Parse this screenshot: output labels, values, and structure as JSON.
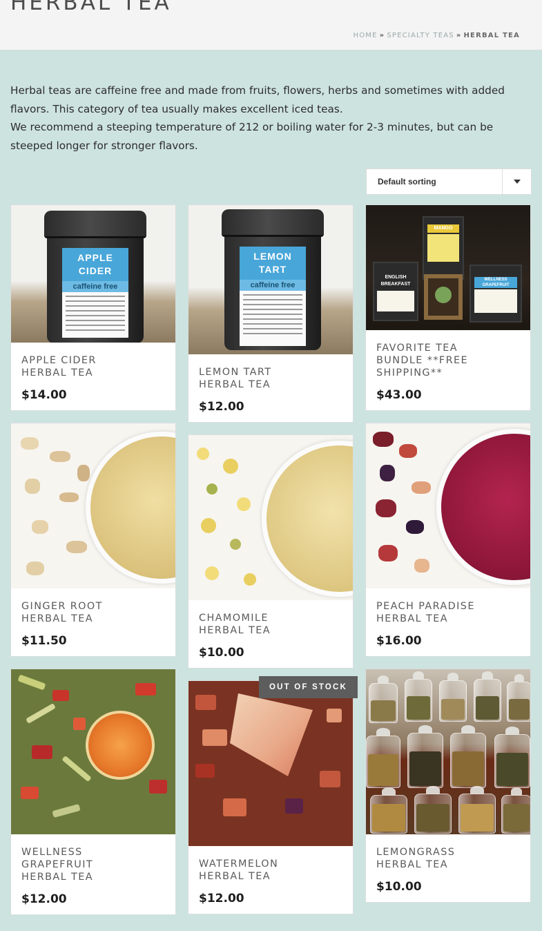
{
  "page": {
    "title": "HERBAL TEA",
    "breadcrumb": {
      "home": "HOME",
      "separator": "»",
      "parent": "SPECIALTY TEAS",
      "current": "HERBAL TEA"
    }
  },
  "intro": {
    "line1": "Herbal teas are caffeine free and made from fruits, flowers, herbs and sometimes with added flavors. This category of tea usually makes excellent iced teas.",
    "line2": "We recommend a steeping temperature of 212 or boiling water for 2-3 minutes, but can be steeped longer for stronger flavors."
  },
  "sorting": {
    "selected": "Default sorting",
    "icon": "chevron-down-icon"
  },
  "products": [
    {
      "name": "APPLE CIDER HERBAL TEA",
      "price": "$14.00",
      "tin_label_line1": "APPLE",
      "tin_label_line2": "CIDER",
      "tin_sub": "caffeine free"
    },
    {
      "name": "LEMON TART HERBAL TEA",
      "price": "$12.00",
      "tin_label_line1": "LEMON",
      "tin_label_line2": "TART",
      "tin_sub": "caffeine free"
    },
    {
      "name": "FAVORITE TEA BUNDLE **FREE SHIPPING**",
      "price": "$43.00",
      "tins": [
        "MANGO",
        "ENGLISH BREAKFAST",
        "WELLNESS GRAPEFRUIT"
      ]
    },
    {
      "name": "GINGER ROOT HERBAL TEA",
      "price": "$11.50"
    },
    {
      "name": "CHAMOMILE HERBAL TEA",
      "price": "$10.00"
    },
    {
      "name": "PEACH PARADISE HERBAL TEA",
      "price": "$16.00"
    },
    {
      "name": "WELLNESS GRAPEFRUIT HERBAL TEA",
      "price": "$12.00"
    },
    {
      "name": "WATERMELON HERBAL TEA",
      "price": "$12.00",
      "badge": "OUT OF STOCK"
    },
    {
      "name": "LEMONGRASS HERBAL TEA",
      "price": "$10.00"
    }
  ],
  "colors": {
    "page_background": "#cde3e0",
    "card_background": "#ffffff",
    "badge_background": "#5d5d5d",
    "tin_label_blue": "#48a6d9"
  }
}
